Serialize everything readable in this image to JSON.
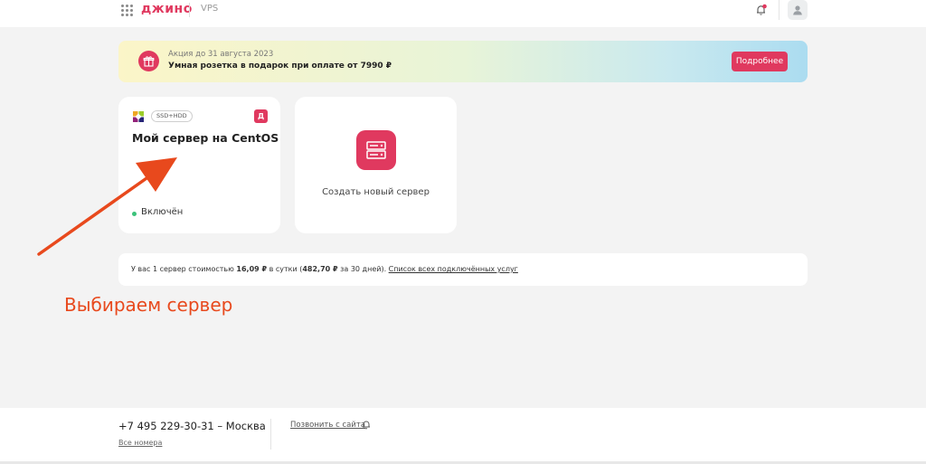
{
  "header": {
    "logo": "джино",
    "product": "VPS"
  },
  "promo": {
    "date": "Акция до 31 августа 2023",
    "text": "Умная розетка в подарок при оплате от 7990 ₽",
    "button": "Подробнее"
  },
  "server_card": {
    "disk_type": "SSD+HDD",
    "provider_letter": "Д",
    "name": "Мой сервер на CentOS",
    "status": "Включён"
  },
  "create_card": {
    "label": "Создать новый сервер"
  },
  "summary": {
    "prefix": "У вас 1 сервер стоимостью ",
    "daily_cost": "16,09 ₽",
    "middle": " в сутки (",
    "monthly_cost": "482,70 ₽",
    "suffix": " за 30 дней). ",
    "link": "Список всех подключённых услуг"
  },
  "annotation": {
    "text": "Выбираем сервер"
  },
  "footer": {
    "phone": "+7 495 229-30-31 – Москва",
    "all_numbers": "Все номера",
    "call_from_site": "Позвонить с сайта"
  },
  "colors": {
    "accent": "#e0395f",
    "status_on": "#3cc27a",
    "annotation": "#e8491d"
  }
}
